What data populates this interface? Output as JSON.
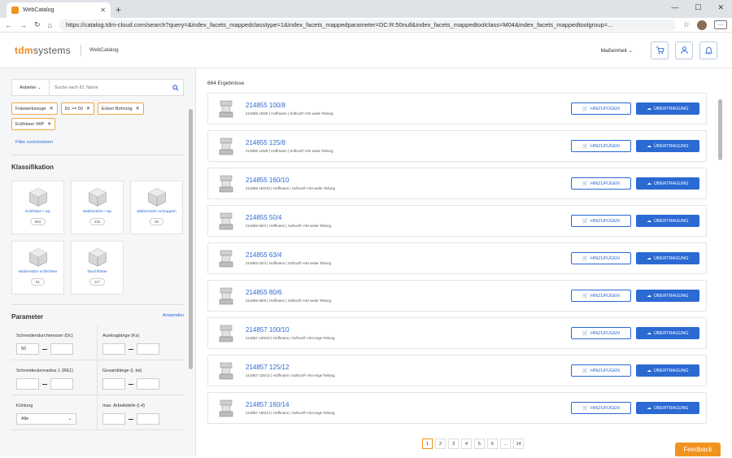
{
  "browser": {
    "tab_title": "WebCatalog",
    "tab_close": "✕",
    "new_tab": "+",
    "url": "https://catalog.tdm-cloud.com/search?query=&index_facets_mappedclasstype=1&index_facets_mappedparameter=DC:R:50null&index_facets_mappedtoolclass=M04&index_facets_mappedtoolgroup=...",
    "back": "←",
    "forward": "→",
    "reload": "↻",
    "home": "⌂",
    "more": "···",
    "win_min": "—",
    "win_max": "☐",
    "win_close": "✕"
  },
  "header": {
    "logo_main": "tdm",
    "logo_sub": "systems",
    "app_name": "WebCatalog",
    "unit_label": "Maßeinheit",
    "unit_caret": "⌄"
  },
  "sidebar": {
    "search_select": "Anbieter ⌄",
    "search_placeholder": "Suche nach ID, Name",
    "chips": [
      {
        "label": "Fräswerkzeuge",
        "x": "✕"
      },
      {
        "label": "Dc >= 50",
        "x": "✕"
      },
      {
        "label": "Ecken Bohrung",
        "x": "✕"
      },
      {
        "label": "Eckfräser /WP",
        "x": "✕"
      }
    ],
    "reset": "Filter zurücksetzen",
    "classification_title": "Klassifikation",
    "classes": [
      {
        "label": "Eckfräser / wp",
        "count": "664"
      },
      {
        "label": "Walzenstirn / wp",
        "count": "432"
      },
      {
        "label": "Walzenstirn schruppen",
        "count": "30"
      },
      {
        "label": "Walzenstirn schlichten",
        "count": "61"
      },
      {
        "label": "Tauchfräser",
        "count": "117"
      }
    ],
    "parameter_title": "Parameter",
    "apply": "Anwenden",
    "params": [
      {
        "label": "Schneidendurchmesser (Dc)",
        "from": "50",
        "to": ""
      },
      {
        "label": "Auskraglänge (Ks)",
        "from": "",
        "to": ""
      },
      {
        "label": "Schneideckenradius 1 (RE1)",
        "from": "",
        "to": ""
      },
      {
        "label": "Gesamtlänge (L tot)",
        "from": "",
        "to": ""
      },
      {
        "label": "Kühlung",
        "select": "Alle"
      },
      {
        "label": "max. Arbeitstiefe (L4)",
        "from": "",
        "to": ""
      }
    ]
  },
  "results": {
    "count": "664 Ergebnisse",
    "add_label": "HINZUFÜGEN",
    "transfer_label": "ÜBERTRAGUNG",
    "items": [
      {
        "title": "214855 100/8",
        "sub": "214855 100/8 | Hoffmann | Softcut® HSI weite Teilung"
      },
      {
        "title": "214855 125/8",
        "sub": "214855 125/8 | Hoffmann | Softcut® HSI weite Teilung"
      },
      {
        "title": "214855 160/10",
        "sub": "214855 160/10 | Hoffmann | Softcut® HSI weite Teilung"
      },
      {
        "title": "214855 50/4",
        "sub": "214855 50/4 | Hoffmann | Softcut® HSI weite Teilung"
      },
      {
        "title": "214855 63/4",
        "sub": "214855 63/4 | Hoffmann | Softcut® HSI weite Teilung"
      },
      {
        "title": "214855 80/6",
        "sub": "214855 80/6 | Hoffmann | Softcut® HSI weite Teilung"
      },
      {
        "title": "214857 100/10",
        "sub": "214857 100/10 | Hoffmann | Softcut® HSI enge Teilung"
      },
      {
        "title": "214857 125/12",
        "sub": "214857 125/12 | Hoffmann | Softcut® HSI enge Teilung"
      },
      {
        "title": "214857 160/14",
        "sub": "214857 160/14 | Hoffmann | Softcut® HSI enge Teilung"
      }
    ],
    "pages": [
      "1",
      "2",
      "3",
      "4",
      "5",
      "6",
      "...",
      "14"
    ]
  },
  "feedback": "Feedback",
  "colors": {
    "accent": "#f0941f",
    "primary": "#2b69d3"
  }
}
